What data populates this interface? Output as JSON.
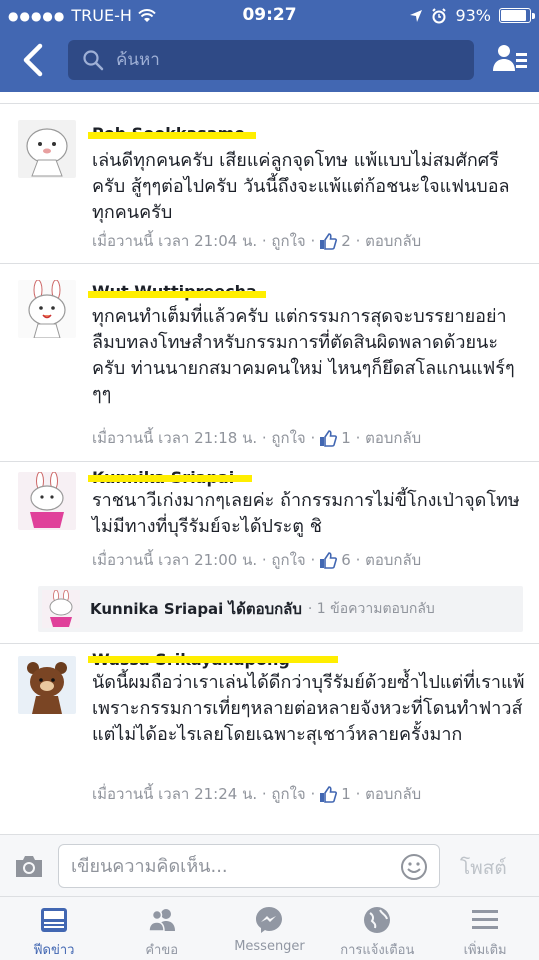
{
  "status_bar": {
    "carrier": "TRUE-H",
    "time": "09:27",
    "battery": "93%",
    "battery_level": 0.93
  },
  "header": {
    "search_placeholder": "ค้นหา",
    "back_icon": "chevron-left-icon",
    "friends_icon": "friend-list-icon"
  },
  "comments": [
    {
      "name": "Poh Sookkasame",
      "text": "เล่นดีทุกคนครับ เสียแค่ลูกจุดโทษ แพ้แบบไม่สมศักศรีครับ สู้ๆๆต่อไปครับ วันนี้ถึงจะแพ้แต่ก้อชนะใจแฟนบอลทุกคนครับ",
      "time": "เมื่อวานนี้ เวลา 21:04 น.",
      "like_label": "ถูกใจ",
      "likes": "2",
      "reply_label": "ตอบกลับ"
    },
    {
      "name": "Wut Wuttipreecha",
      "text": "ทุกคนทำเต็มที่แล้วครับ แต่กรรมการสุดจะบรรยายอย่าลืมบทลงโทษสำหรับกรรมการที่ตัดสินผิดพลาดด้วยนะครับ ท่านนายกสมาคมคนใหม่ ไหนๆก็ยึดสโลแกนแฟร์ๆๆๆ",
      "time": "เมื่อวานนี้ เวลา 21:18 น.",
      "like_label": "ถูกใจ",
      "likes": "1",
      "reply_label": "ตอบกลับ"
    },
    {
      "name": "Kunnika Sriapai",
      "text": "ราชนาวีเก่งมากๆเลยค่ะ ถ้ากรรมการไม่ขี้โกงเป่าจุดโทษไม่มีทางที่บุรีรัมย์จะได้ประตู ชิ",
      "time": "เมื่อวานนี้ เวลา 21:00 น.",
      "like_label": "ถูกใจ",
      "likes": "6",
      "reply_label": "ตอบกลับ"
    },
    {
      "name": "Wassa Srikayanapong",
      "text": "นัดนี้ผมถือว่าเราเล่นได้ดีกว่าบุรีรัมย์ด้วยซ้ำไปแต่ที่เราแพ้เพราะกรรมการเที่ยๆหลายต่อหลายจังหวะที่โดนทำฟาวส์แต่ไม่ได้อะไรเลยโดยเฉพาะสุเชาว์หลายครั้งมาก",
      "time": "เมื่อวานนี้ เวลา 21:24 น.",
      "like_label": "ถูกใจ",
      "likes": "1",
      "reply_label": "ตอบกลับ"
    }
  ],
  "reply_summary": {
    "name": "Kunnika Sriapai ได้ตอบกลับ",
    "info": "· 1 ข้อความตอบกลับ"
  },
  "composer": {
    "placeholder": "เขียนความคิดเห็น...",
    "post_label": "โพสต์"
  },
  "tabs": [
    {
      "label": "ฟีดข่าว",
      "icon": "news-feed-icon",
      "active": true
    },
    {
      "label": "คำขอ",
      "icon": "friend-requests-icon",
      "active": false
    },
    {
      "label": "Messenger",
      "icon": "messenger-icon",
      "active": false
    },
    {
      "label": "การแจ้งเตือน",
      "icon": "notifications-globe-icon",
      "active": false
    },
    {
      "label": "เพิ่มเติม",
      "icon": "more-menu-icon",
      "active": false
    }
  ],
  "colors": {
    "brand": "#4267b2",
    "highlight": "#ffee00",
    "meta": "#90949c"
  }
}
